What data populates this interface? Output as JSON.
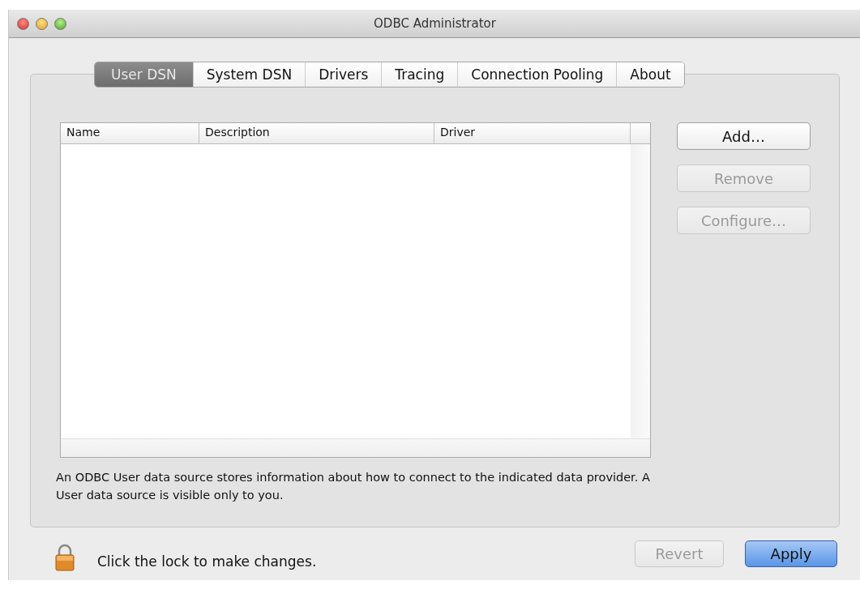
{
  "window": {
    "title": "ODBC Administrator"
  },
  "tabs": [
    {
      "label": "User DSN",
      "selected": true
    },
    {
      "label": "System DSN",
      "selected": false
    },
    {
      "label": "Drivers",
      "selected": false
    },
    {
      "label": "Tracing",
      "selected": false
    },
    {
      "label": "Connection Pooling",
      "selected": false
    },
    {
      "label": "About",
      "selected": false
    }
  ],
  "table": {
    "columns": [
      "Name",
      "Description",
      "Driver"
    ]
  },
  "side_buttons": [
    {
      "label": "Add…",
      "disabled": false
    },
    {
      "label": "Remove",
      "disabled": true
    },
    {
      "label": "Configure…",
      "disabled": true
    }
  ],
  "description": "An ODBC User data source stores information about how to connect to the indicated data provider. A User data source is visible only to you.",
  "lock": {
    "label": "Click the lock to make changes."
  },
  "bottom_buttons": [
    {
      "label": "Revert",
      "disabled": true,
      "default": false
    },
    {
      "label": "Apply",
      "disabled": false,
      "default": true
    }
  ]
}
